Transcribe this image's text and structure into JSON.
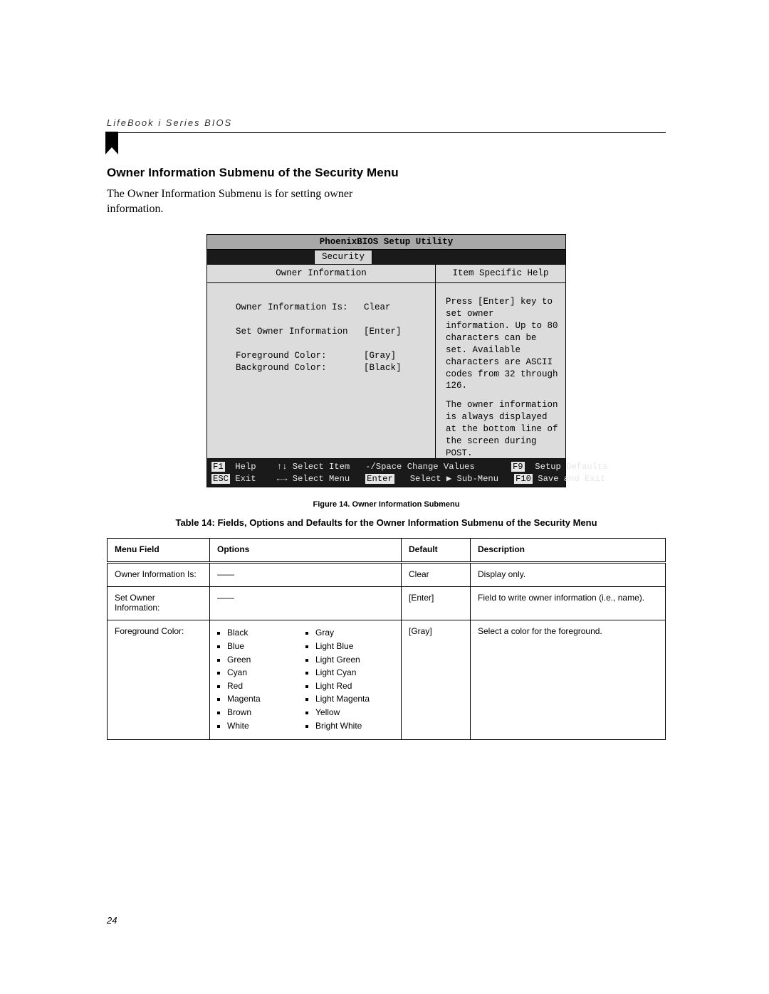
{
  "header": {
    "running": "LifeBook i Series BIOS"
  },
  "section": {
    "heading": "Owner Information Submenu of the Security Menu",
    "intro": "The Owner Information Submenu is for setting owner information."
  },
  "bios": {
    "title": "PhoenixBIOS Setup Utility",
    "active_tab": "Security",
    "left_heading": "Owner Information",
    "rows": [
      {
        "label": "Owner Information Is:",
        "value": "Clear"
      },
      {
        "label": "Set Owner Information",
        "value": "[Enter]"
      },
      {
        "label": "Foreground Color:",
        "value": "[Gray]"
      },
      {
        "label": "Background Color:",
        "value": "[Black]"
      }
    ],
    "help_heading": "Item Specific Help",
    "help_p1": "Press [Enter] key to set owner information. Up to 80 characters can be set. Available characters are ASCII codes from 32 through 126.",
    "help_p2": "The owner information is always displayed at the bottom line of the screen during POST.",
    "footer": {
      "f1": "F1",
      "help": "Help",
      "select_item": "Select Item",
      "change_values_keys": "-/Space",
      "change_values": "Change Values",
      "f9": "F9",
      "setup_defaults": "Setup Defaults",
      "esc": "ESC",
      "exit": "Exit",
      "select_menu": "Select Menu",
      "enter": "Enter",
      "select_submenu": "Select ▶ Sub-Menu",
      "f10": "F10",
      "save_exit": "Save and Exit"
    }
  },
  "figure_caption": "Figure 14. Owner Information Submenu",
  "table_caption": "Table 14: Fields, Options and Defaults for the Owner Information Submenu of the Security Menu",
  "table": {
    "headers": {
      "menu_field": "Menu Field",
      "options": "Options",
      "default": "Default",
      "description": "Description"
    },
    "rows": [
      {
        "menu_field": "Owner Information Is:",
        "options_plain": "——",
        "default": "Clear",
        "description": "Display only."
      },
      {
        "menu_field": "Set Owner Information:",
        "options_plain": "——",
        "default": "[Enter]",
        "description": "Field to write owner information (i.e., name)."
      },
      {
        "menu_field": "Foreground Color:",
        "options_col1": [
          "Black",
          "Blue",
          "Green",
          "Cyan",
          "Red",
          "Magenta",
          "Brown",
          "White"
        ],
        "options_col2": [
          "Gray",
          "Light Blue",
          "Light Green",
          "Light Cyan",
          "Light Red",
          "Light Magenta",
          "Yellow",
          "Bright White"
        ],
        "default": "[Gray]",
        "description": "Select a color for the foreground."
      }
    ]
  },
  "page_number": "24"
}
